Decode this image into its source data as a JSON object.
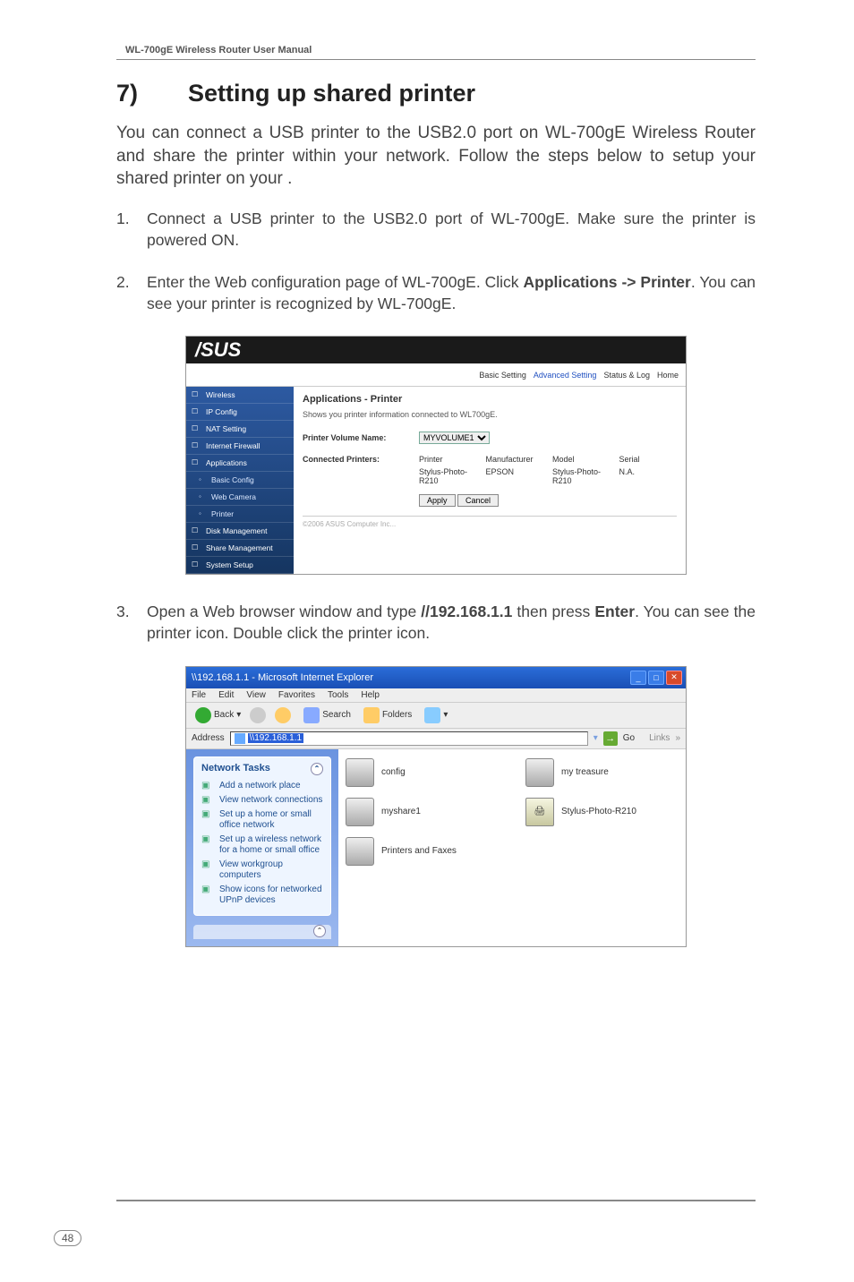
{
  "header": "WL-700gE Wireless Router User Manual",
  "title_num": "7)",
  "title": "Setting up shared printer",
  "intro": "You can connect a USB printer to the USB2.0 port on WL-700gE Wireless Router and share the printer within your network. Follow the steps below to setup your shared printer on your .",
  "steps": [
    "Connect a USB printer to the USB2.0 port of WL-700gE. Make sure the printer is powered ON.",
    "Enter the Web configuration page of WL-700gE. Click Applications -> Printer. You can see your printer is recognized by WL-700gE.",
    "Open a Web browser window and type //192.168.1.1 then press Enter. You can see the printer icon. Double click the printer icon."
  ],
  "step2_bold": "Applications -> Printer",
  "step3_bold1": "//192.168.1.1",
  "step3_bold2": "Enter",
  "page_number": "48",
  "shot1": {
    "logo": "/SUS",
    "crumbs": [
      "Basic Setting",
      "Advanced Setting",
      "Status & Log",
      "Home"
    ],
    "sidebar": [
      {
        "label": "Wireless",
        "sub": false
      },
      {
        "label": "IP Config",
        "sub": false
      },
      {
        "label": "NAT Setting",
        "sub": false
      },
      {
        "label": "Internet Firewall",
        "sub": false
      },
      {
        "label": "Applications",
        "sub": false
      },
      {
        "label": "Basic Config",
        "sub": true
      },
      {
        "label": "Web Camera",
        "sub": true
      },
      {
        "label": "Printer",
        "sub": true
      },
      {
        "label": "Disk Management",
        "sub": false
      },
      {
        "label": "Share Management",
        "sub": false
      },
      {
        "label": "System Setup",
        "sub": false
      }
    ],
    "heading": "Applications - Printer",
    "desc": "Shows you printer information connected to WL700gE.",
    "vol_label": "Printer Volume Name:",
    "vol_value": "MYVOLUME1",
    "conn_label": "Connected Printers:",
    "table": {
      "headers": [
        "Printer",
        "Manufacturer",
        "Model",
        "Serial"
      ],
      "row": [
        "Stylus-Photo-R210",
        "EPSON",
        "Stylus-Photo-R210",
        "N.A."
      ]
    },
    "btn_apply": "Apply",
    "btn_cancel": "Cancel",
    "copyright": "©2006 ASUS Computer Inc..."
  },
  "shot2": {
    "title": "\\\\192.168.1.1 - Microsoft Internet Explorer",
    "menus": [
      "File",
      "Edit",
      "View",
      "Favorites",
      "Tools",
      "Help"
    ],
    "tool_back": "Back",
    "tool_search": "Search",
    "tool_folders": "Folders",
    "addr_label": "Address",
    "addr_value": "\\\\192.168.1.1",
    "go": "Go",
    "links": "Links",
    "panel_title": "Network Tasks",
    "tasks": [
      "Add a network place",
      "View network connections",
      "Set up a home or small office network",
      "Set up a wireless network for a home or small office",
      "View workgroup computers",
      "Show icons for networked UPnP devices"
    ],
    "icons": [
      {
        "label": "config",
        "kind": "folder"
      },
      {
        "label": "my treasure",
        "kind": "folder"
      },
      {
        "label": "myshare1",
        "kind": "folder"
      },
      {
        "label": "Stylus-Photo-R210",
        "kind": "printer"
      },
      {
        "label": "Printers and Faxes",
        "kind": "folder"
      }
    ]
  }
}
